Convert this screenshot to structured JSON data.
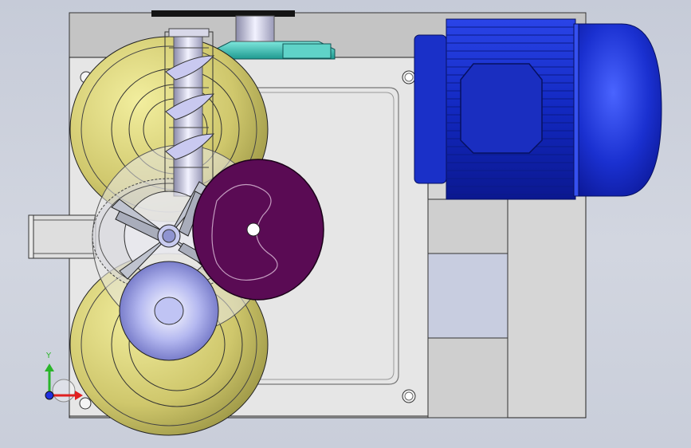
{
  "viewport": {
    "background_color": "#ccd1dc"
  },
  "triad": {
    "y_label": "Y",
    "y_color": "#2ab52a",
    "x_color": "#e02020",
    "z_color": "#2030e0"
  },
  "colors": {
    "frame": "#d8d8d8",
    "frame_dark": "#bcbcbc",
    "motor": "#1e36d8",
    "pulley": "#c9c36a",
    "cam": "#5a0b54",
    "coupling": "#3fbfb5",
    "auger": "#b8b8e8"
  }
}
